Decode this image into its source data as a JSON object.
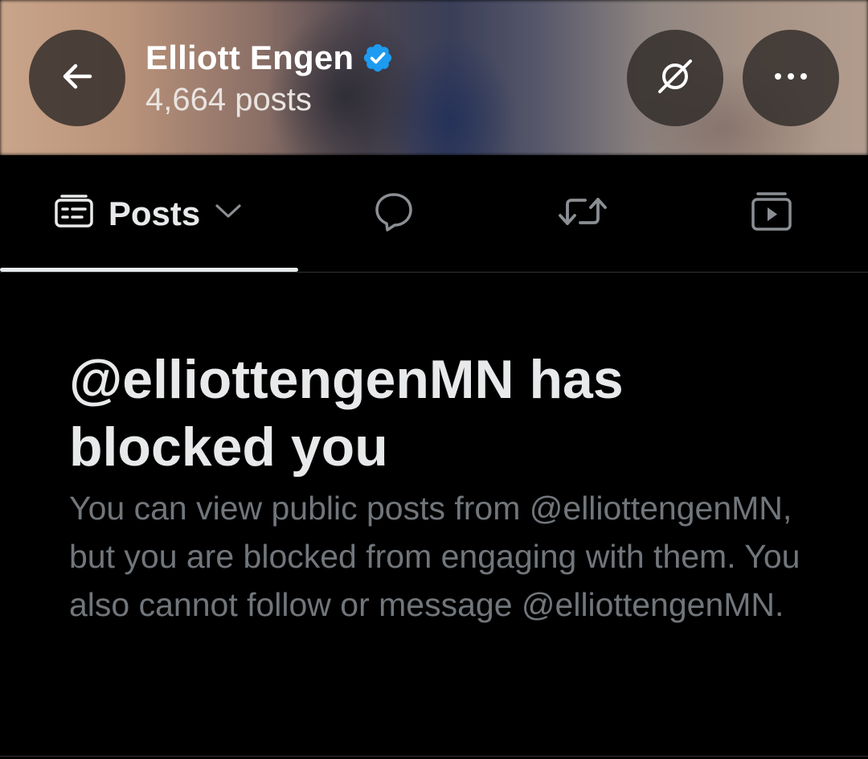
{
  "header": {
    "name": "Elliott Engen",
    "post_count": "4,664 posts",
    "verified": true,
    "back_icon": "arrow-left-icon",
    "notify_icon": "notifications-off-icon",
    "more_icon": "more-horizontal-icon"
  },
  "tabs": {
    "posts_label": "Posts",
    "posts_icon": "timeline-icon",
    "replies_icon": "reply-bubble-icon",
    "reposts_icon": "repost-icon",
    "media_icon": "video-icon"
  },
  "blocked": {
    "title": "@elliottengenMN has blocked you",
    "body": "You can view public posts from @elliottengenMN, but you are blocked from engaging with them. You also cannot follow or message @elliottengenMN."
  },
  "colors": {
    "background": "#000000",
    "primary_text": "#e7e9ea",
    "secondary_text": "#71767b",
    "verified_blue": "#1d9bf0",
    "divider": "#2f3336"
  }
}
